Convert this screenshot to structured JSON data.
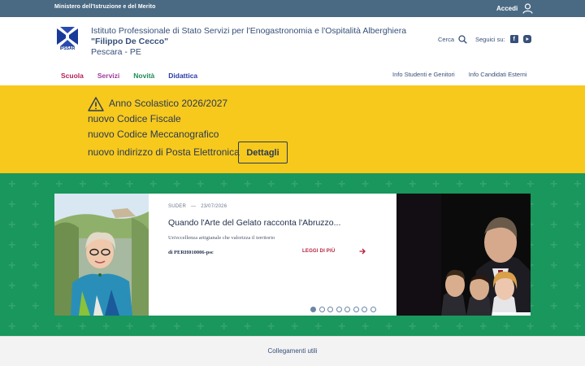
{
  "topbar": {
    "ministry": "Ministero dell'Istruzione e del Merito",
    "login": "Accedi",
    "background": "#4a6a83"
  },
  "header": {
    "logo_caption": "IPSSAR",
    "school_name_line1": "Istituto Professionale di Stato Servizi per l'Enogastronomia e l'Ospitalità Alberghiera",
    "school_name_line2": "\"Filippo De Cecco\"",
    "school_location": "Pescara - PE",
    "search_label": "Cerca",
    "follow_label": "Seguici su:",
    "social_icons": [
      "facebook-icon",
      "youtube-icon"
    ]
  },
  "nav": {
    "items": [
      {
        "label": "Scuola",
        "color": "#b41e5a"
      },
      {
        "label": "Servizi",
        "color": "#a23a9a"
      },
      {
        "label": "Novità",
        "color": "#1f8a58"
      },
      {
        "label": "Didattica",
        "color": "#2a3aa8"
      }
    ],
    "right_items": [
      "Info Studenti e Genitori",
      "Info Candidati Esterni"
    ]
  },
  "notice": {
    "line1": "Anno Scolastico 2026/2027",
    "line2": "nuovo Codice Fiscale",
    "line3": "nuovo Codice Meccanografico",
    "line4": "nuovo indirizzo di Posta Elettronica",
    "button": "Dettagli",
    "background": "#f7c91c"
  },
  "carousel": {
    "background": "#19975c",
    "slide": {
      "category": "SUDER",
      "separator": "—",
      "date": "23/07/2026",
      "title": "Quando l'Arte del Gelato racconta l'Abruzzo...",
      "subtitle": "Un'eccellenza artigianale che valorizza il territorio",
      "author": "di PERH010006-psc",
      "read_more": "LEGGI DI PIÙ"
    },
    "dot_count": 8,
    "active_dot": 1
  },
  "footer": {
    "links_title": "Collegamenti utili"
  }
}
